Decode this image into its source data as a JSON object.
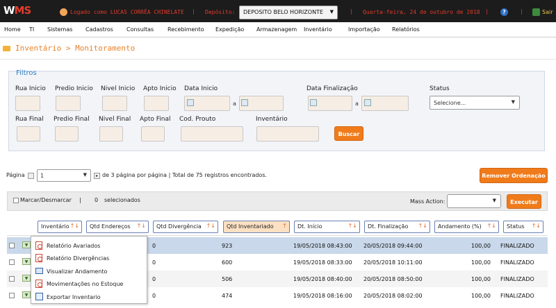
{
  "header": {
    "logo_main": "W",
    "logo_accent": "MS",
    "user": "Logado como LUCAS CORRÊA CHINELATE",
    "deposit_label": "Depósito:",
    "deposit_value": "DEPOSITO BELO HORIZONTE",
    "separator": "|",
    "date": "Quarta-feira, 24 de outubro de 2018",
    "help_glyph": "?",
    "exit_label": "Sair"
  },
  "menu": [
    "Home",
    "TI",
    "Sistemas",
    "Cadastros",
    "Consultas",
    "Recebimento",
    "Expedição",
    "Armazenagem",
    "Inventário",
    "Importação",
    "Relatórios"
  ],
  "page_title": "Inventário > Monitoramento",
  "filters": {
    "title": "Filtros",
    "rua_inicio": "Rua Inicio",
    "predio_inicio": "Predio Inicio",
    "nivel_inicio": "Nivel Inicio",
    "apto_inicio": "Apto Inicio",
    "data_inicio": "Data Inicio",
    "data_finalizacao": "Data Finalização",
    "status": "Status",
    "status_value": "Selecione...",
    "range_sep": "a",
    "rua_final": "Rua Final",
    "predio_final": "Predio Final",
    "nivel_final": "Nivel Final",
    "apto_final": "Apto Final",
    "cod_produto": "Cod. Prouto",
    "inventario": "Inventário",
    "search_button": "Buscar"
  },
  "pagination": {
    "label": "Página",
    "page_value": "1",
    "summary": "de 3 página por página | Total de 75 registros encontrados."
  },
  "remove_order_button": "Remover Ordenação",
  "action_bar": {
    "select_all": "Marcar/Desmarcar",
    "sep": "|",
    "selected_count": "0",
    "selected_label": "selecionados",
    "mass_action_label": "Mass Action:",
    "execute_button": "Executar"
  },
  "grid": {
    "columns": [
      "Inventário",
      "Qtd Endereços",
      "Qtd Divergência",
      "Qtd Inventariado",
      "Dt. Início",
      "Dt. Finalização",
      "Andamento (%)",
      "Status"
    ],
    "rows": [
      {
        "qtd_end": "0",
        "qtd_inv": "923",
        "dt_ini": "19/05/2018 08:43:00",
        "dt_fim": "20/05/2018 09:44:00",
        "andamento": "100,00",
        "status": "FINALIZADO"
      },
      {
        "qtd_end": "0",
        "qtd_inv": "600",
        "dt_ini": "19/05/2018 08:33:00",
        "dt_fim": "20/05/2018 10:11:00",
        "andamento": "100,00",
        "status": "FINALIZADO"
      },
      {
        "qtd_end": "0",
        "qtd_inv": "506",
        "dt_ini": "19/05/2018 08:40:00",
        "dt_fim": "20/05/2018 08:50:00",
        "andamento": "100,00",
        "status": "FINALIZADO"
      },
      {
        "qtd_end": "0",
        "qtd_inv": "474",
        "dt_ini": "19/05/2018 08:16:00",
        "dt_fim": "20/05/2018 08:02:00",
        "andamento": "100,00",
        "status": "FINALIZADO"
      }
    ]
  },
  "context_menu": [
    "Relatório Avariados",
    "Relatório Divergências",
    "Visualizar Andamento",
    "Movimentações no Estoque",
    "Exportar Inventario"
  ],
  "glyphs": {
    "dropdown": "▼",
    "sort": "↑↓",
    "sort_active": "↑",
    "expand": "▼",
    "next": "▸"
  }
}
